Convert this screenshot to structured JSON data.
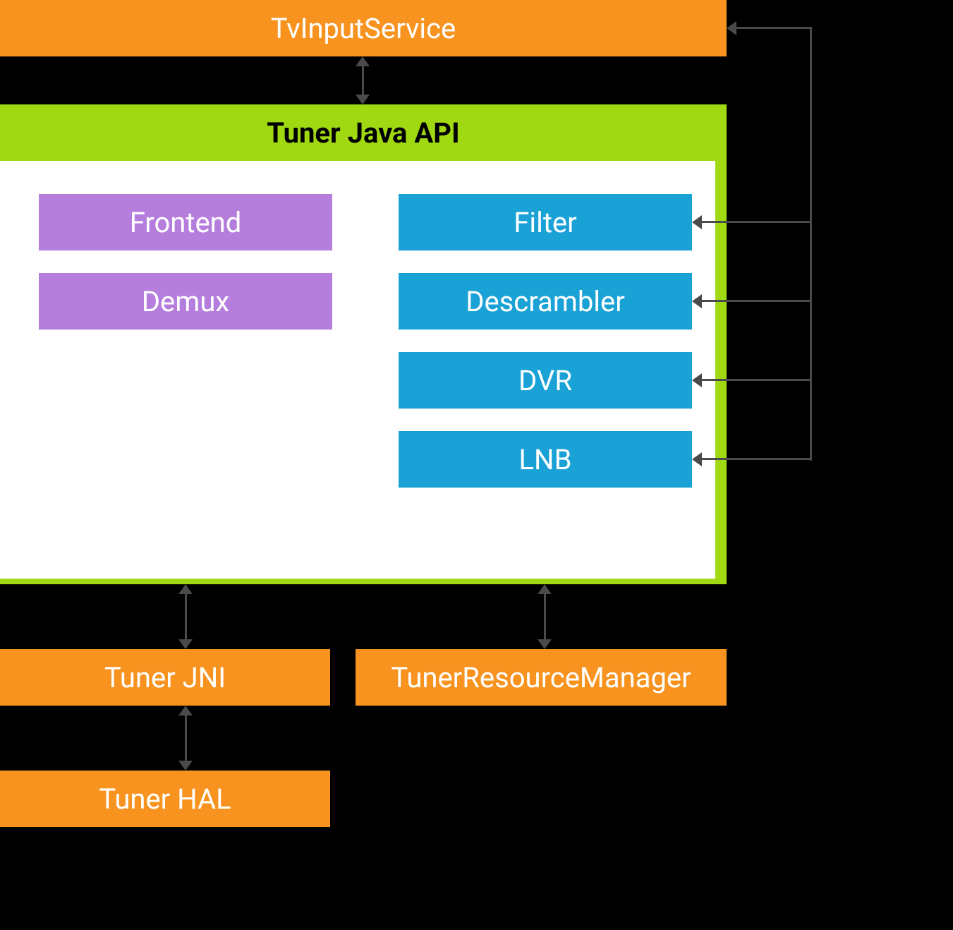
{
  "diagram": {
    "top_bar": "TvInputService",
    "api_container": {
      "title": "Tuner Java API",
      "left_items": [
        "Frontend",
        "Demux"
      ],
      "right_items": [
        "Filter",
        "Descrambler",
        "DVR",
        "LNB"
      ]
    },
    "bottom_left": "Tuner JNI",
    "bottom_right": "TunerResourceManager",
    "hal": "Tuner HAL"
  },
  "colors": {
    "orange": "#F7931E",
    "lime": "#A0D911",
    "purple": "#B57EDC",
    "blue": "#1AA2D6",
    "black": "#000000"
  },
  "connections": [
    {
      "from": "TvInputService",
      "to": "Tuner Java API",
      "type": "bidirectional"
    },
    {
      "from": "Tuner Java API",
      "to": "Tuner JNI",
      "type": "bidirectional"
    },
    {
      "from": "Tuner Java API",
      "to": "TunerResourceManager",
      "type": "bidirectional"
    },
    {
      "from": "Tuner JNI",
      "to": "Tuner HAL",
      "type": "bidirectional"
    },
    {
      "from": "external-right",
      "to": "TvInputService",
      "type": "incoming"
    },
    {
      "from": "external-right",
      "to": "Filter",
      "type": "incoming"
    },
    {
      "from": "external-right",
      "to": "Descrambler",
      "type": "incoming"
    },
    {
      "from": "external-right",
      "to": "DVR",
      "type": "incoming"
    },
    {
      "from": "external-right",
      "to": "LNB",
      "type": "incoming"
    }
  ]
}
